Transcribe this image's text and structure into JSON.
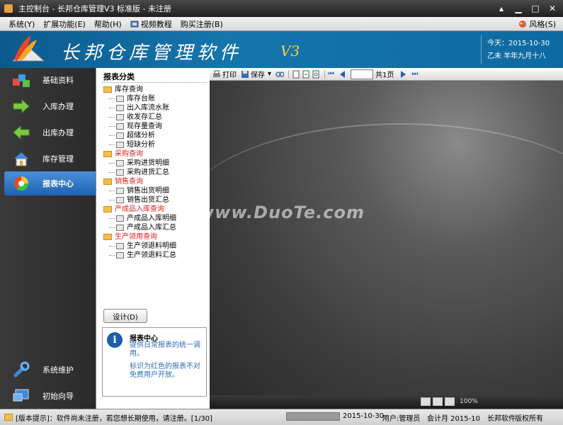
{
  "window": {
    "title": "主控制台 - 长邦仓库管理V3 标准版 - 未注册",
    "controls": [
      "▴",
      "▁",
      "□",
      "✕"
    ]
  },
  "menu": {
    "items": [
      "系统(Y)",
      "扩展功能(E)",
      "帮助(H)",
      "视频教程",
      "购买注册(B)"
    ],
    "style": "风格(S)"
  },
  "banner": {
    "app_name": "长邦仓库管理软件",
    "version": "V3",
    "date": "今天：2015-10-30",
    "lunar": "乙未 羊年九月十八"
  },
  "nav": {
    "items": [
      {
        "label": "基础资料",
        "icon": "cubes-icon"
      },
      {
        "label": "入库办理",
        "icon": "arrow-right-icon"
      },
      {
        "label": "出库办理",
        "icon": "arrow-left-icon"
      },
      {
        "label": "库存管理",
        "icon": "house-icon"
      },
      {
        "label": "报表中心",
        "icon": "chart-circle-icon",
        "active": true
      }
    ],
    "bottom": [
      {
        "label": "系统维护",
        "icon": "wrench-icon"
      },
      {
        "label": "初始向导",
        "icon": "monitor-icon"
      }
    ]
  },
  "report": {
    "header": "报表分类",
    "groups": [
      {
        "name": "库存查询",
        "red": false,
        "items": [
          "库存台账",
          "出入库流水账",
          "收发存汇总",
          "现存量查询",
          "超储分析",
          "短缺分析"
        ]
      },
      {
        "name": "采购查询",
        "red": true,
        "items": [
          "采购进货明细",
          "采购进货汇总"
        ]
      },
      {
        "name": "销售查询",
        "red": true,
        "items": [
          "销售出货明细",
          "销售出货汇总"
        ]
      },
      {
        "name": "产成品入库查询",
        "red": true,
        "items": [
          "产成品入库明细",
          "产成品入库汇总"
        ]
      },
      {
        "name": "生产领用查询",
        "red": true,
        "items": [
          "生产领退料明细",
          "生产领退料汇总"
        ]
      }
    ],
    "design_button": "设计(D)",
    "info_title": "报表中心",
    "info_desc": "提供日常报表的统一调用。",
    "info_note": "标识为红色的报表不对免费用户开放。"
  },
  "toolbar": {
    "print": "打印",
    "save": "保存",
    "page_total": "共1页"
  },
  "viewer": {
    "watermark": "www.DuoTe.com",
    "zoom": "100%"
  },
  "status": {
    "hint": "[版本提示]：软件尚未注册，若您想长期使用，请注册。[1/30]",
    "date": "2015-10-30",
    "user": "用户:管理员",
    "period": "会计月 2015-10",
    "brand": "长邦软件",
    "rights": "版权所有"
  },
  "colors": {
    "banner_blue": "#0e6aa1",
    "active_nav": "#1d63b3",
    "red_text": "#e02020",
    "info_blue": "#2f6db3"
  }
}
